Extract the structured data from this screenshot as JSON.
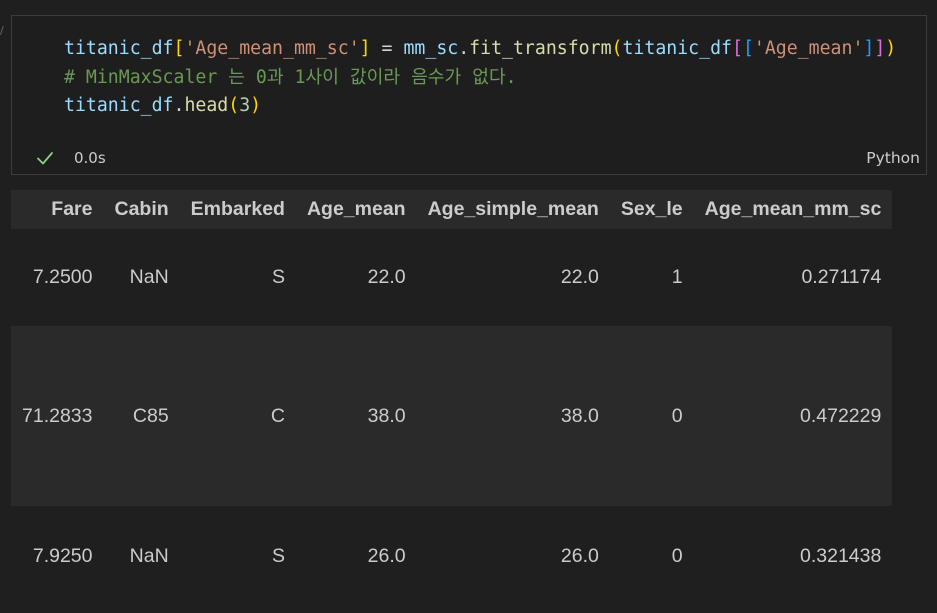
{
  "cell": {
    "code_lines": [
      [
        {
          "t": "titanic_df",
          "c": "tk-var"
        },
        {
          "t": "[",
          "c": "br1"
        },
        {
          "t": "'Age_mean_mm_sc'",
          "c": "tk-str"
        },
        {
          "t": "]",
          "c": "br1"
        },
        {
          "t": " = ",
          "c": "tk-op"
        },
        {
          "t": "mm_sc",
          "c": "tk-var"
        },
        {
          "t": ".",
          "c": "tk-op"
        },
        {
          "t": "fit_transform",
          "c": "tk-fn"
        },
        {
          "t": "(",
          "c": "br1"
        },
        {
          "t": "titanic_df",
          "c": "tk-var"
        },
        {
          "t": "[",
          "c": "br2"
        },
        {
          "t": "[",
          "c": "br3"
        },
        {
          "t": "'Age_mean'",
          "c": "tk-str"
        },
        {
          "t": "]",
          "c": "br3"
        },
        {
          "t": "]",
          "c": "br2"
        },
        {
          "t": ")",
          "c": "br1"
        }
      ],
      [
        {
          "t": "# MinMaxScaler 는 0과 1사이 값이라 음수가 없다.",
          "c": "tk-cmt"
        }
      ],
      [
        {
          "t": "titanic_df",
          "c": "tk-var"
        },
        {
          "t": ".",
          "c": "tk-op"
        },
        {
          "t": "head",
          "c": "tk-fn"
        },
        {
          "t": "(",
          "c": "br1"
        },
        {
          "t": "3",
          "c": "tk-num"
        },
        {
          "t": ")",
          "c": "br1"
        }
      ]
    ],
    "status": {
      "icon": "check-icon",
      "duration": "0.0s",
      "language": "Python",
      "success_color": "#89d185"
    }
  },
  "output_table": {
    "columns": [
      "Fare",
      "Cabin",
      "Embarked",
      "Age_mean",
      "Age_simple_mean",
      "Sex_le",
      "Age_mean_mm_sc"
    ],
    "rows": [
      [
        "7.2500",
        "NaN",
        "S",
        "22.0",
        "22.0",
        "1",
        "0.271174"
      ],
      [
        "71.2833",
        "C85",
        "C",
        "38.0",
        "38.0",
        "0",
        "0.472229"
      ],
      [
        "7.9250",
        "NaN",
        "S",
        "26.0",
        "26.0",
        "0",
        "0.321438"
      ]
    ]
  }
}
